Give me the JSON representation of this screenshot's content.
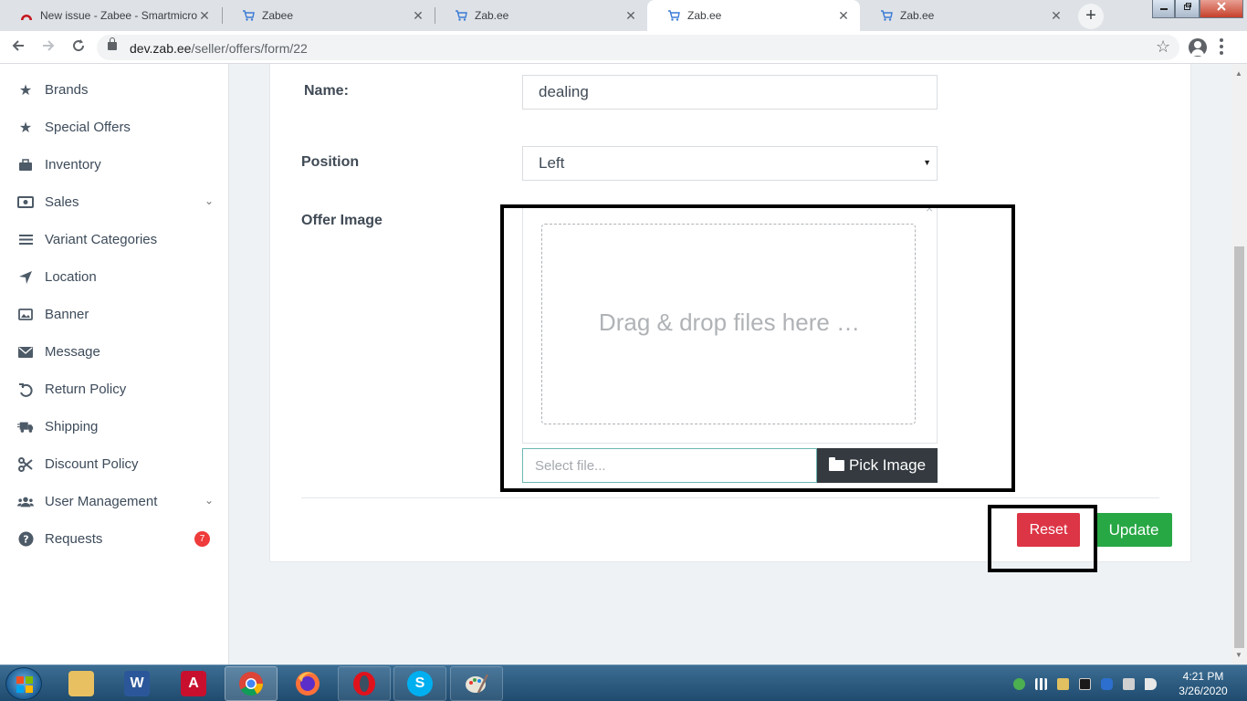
{
  "browser": {
    "tabs": [
      {
        "title": "New issue - Zabee - Smartmicro",
        "favicon": "redmine-icon",
        "active": false
      },
      {
        "title": "Zabee",
        "favicon": "cart-icon",
        "active": false
      },
      {
        "title": "Zab.ee",
        "favicon": "cart-icon",
        "active": false
      },
      {
        "title": "Zab.ee",
        "favicon": "cart-icon",
        "active": true
      },
      {
        "title": "Zab.ee",
        "favicon": "cart-icon",
        "active": false
      }
    ],
    "close_glyph": "✕",
    "new_tab_glyph": "+",
    "url_host": "dev.zab.ee",
    "url_path": "/seller/offers/form/22"
  },
  "sidebar": {
    "items": [
      {
        "label": "Brands",
        "icon": "star-icon"
      },
      {
        "label": "Special Offers",
        "icon": "star-icon"
      },
      {
        "label": "Inventory",
        "icon": "briefcase-icon"
      },
      {
        "label": "Sales",
        "icon": "money-icon",
        "chevron": "⌄"
      },
      {
        "label": "Variant Categories",
        "icon": "list-icon"
      },
      {
        "label": "Location",
        "icon": "location-arrow-icon"
      },
      {
        "label": "Banner",
        "icon": "image-icon"
      },
      {
        "label": "Message",
        "icon": "envelope-icon"
      },
      {
        "label": "Return Policy",
        "icon": "undo-icon"
      },
      {
        "label": "Shipping",
        "icon": "truck-icon"
      },
      {
        "label": "Discount Policy",
        "icon": "scissors-icon"
      },
      {
        "label": "User Management",
        "icon": "users-icon",
        "chevron": "⌄"
      },
      {
        "label": "Requests",
        "icon": "question-icon",
        "badge": "7"
      }
    ]
  },
  "form": {
    "name_label": "Name:",
    "name_value": "dealing",
    "position_label": "Position",
    "position_value": "Left",
    "offer_image_label": "Offer Image",
    "dropzone_close": "×",
    "dropzone_text": "Drag & drop files here …",
    "file_placeholder": "Select file...",
    "pick_image_label": "Pick Image",
    "reset_label": "Reset",
    "update_label": "Update"
  },
  "colors": {
    "reset": "#dc3545",
    "update": "#28a745",
    "pick_image": "#343a40",
    "badge": "#ef3b3b"
  },
  "taskbar": {
    "apps": [
      "windows-explorer-icon",
      "word-icon",
      "acrobat-icon",
      "chrome-icon",
      "firefox-icon",
      "opera-icon",
      "skype-icon",
      "paint-icon"
    ],
    "time": "4:21 PM",
    "date": "3/26/2020"
  }
}
